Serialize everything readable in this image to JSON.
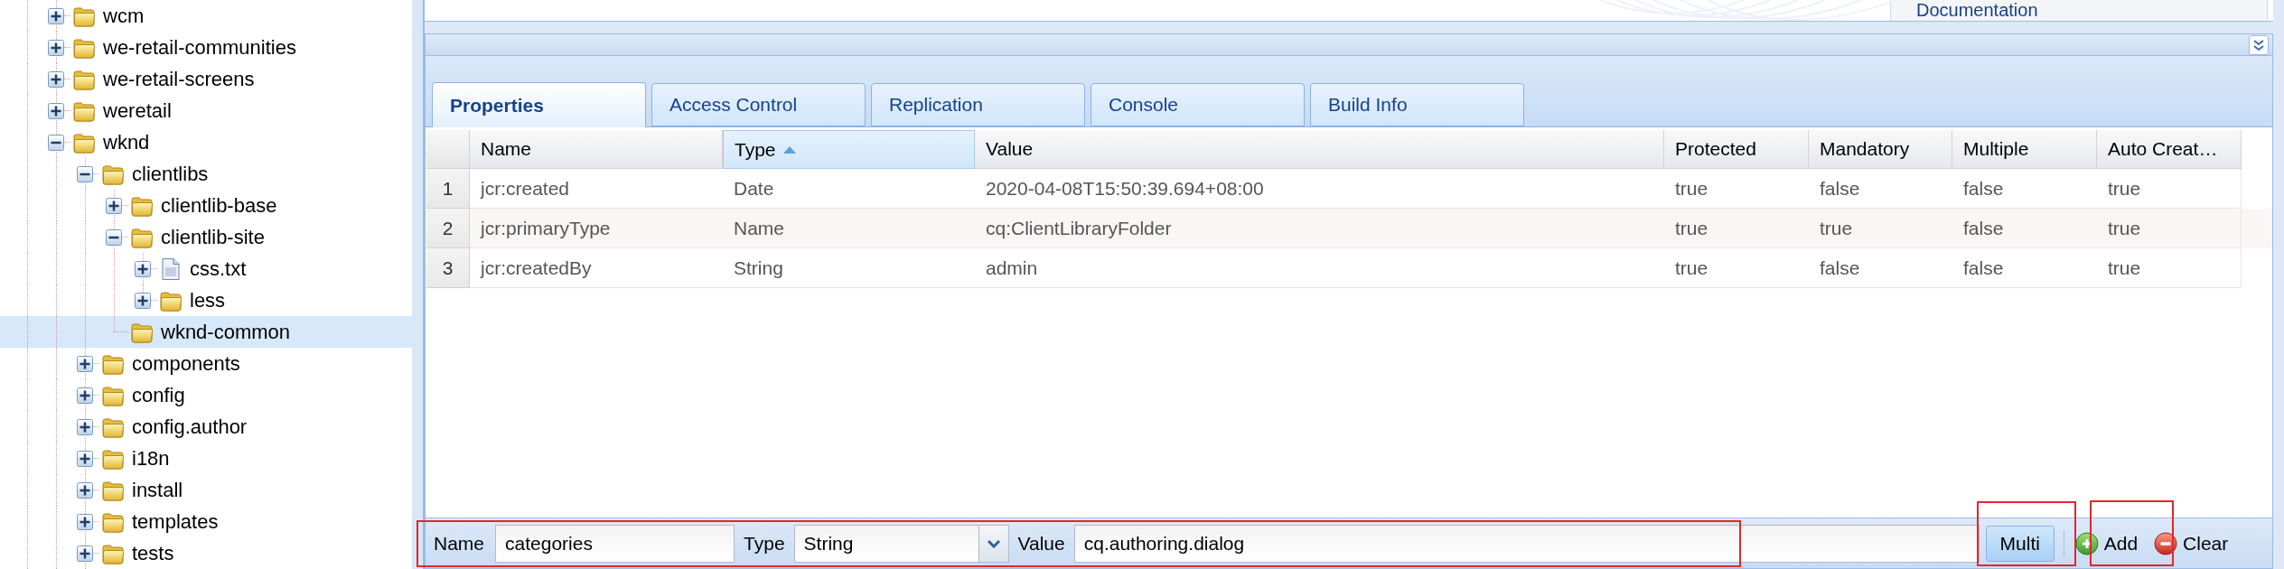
{
  "tree": [
    {
      "label": "wcm",
      "kind": "folder",
      "leaf": false,
      "expanded": false,
      "selected": false
    },
    {
      "label": "we-retail-communities",
      "kind": "folder",
      "leaf": false,
      "expanded": false,
      "selected": false
    },
    {
      "label": "we-retail-screens",
      "kind": "folder",
      "leaf": false,
      "expanded": false,
      "selected": false
    },
    {
      "label": "weretail",
      "kind": "folder",
      "leaf": false,
      "expanded": false,
      "selected": false
    },
    {
      "label": "wknd",
      "kind": "folder",
      "leaf": false,
      "expanded": true,
      "selected": false,
      "children": [
        {
          "label": "clientlibs",
          "kind": "folder",
          "leaf": false,
          "expanded": true,
          "selected": false,
          "children": [
            {
              "label": "clientlib-base",
              "kind": "folder",
              "leaf": false,
              "expanded": false,
              "selected": false
            },
            {
              "label": "clientlib-site",
              "kind": "folder",
              "leaf": false,
              "expanded": true,
              "selected": false,
              "children": [
                {
                  "label": "css.txt",
                  "kind": "file",
                  "leaf": false,
                  "expanded": false,
                  "selected": false
                },
                {
                  "label": "less",
                  "kind": "folder",
                  "leaf": false,
                  "expanded": false,
                  "selected": false
                }
              ]
            },
            {
              "label": "wknd-common",
              "kind": "folder",
              "leaf": true,
              "selected": true
            }
          ]
        },
        {
          "label": "components",
          "kind": "folder",
          "leaf": false,
          "expanded": false,
          "selected": false
        },
        {
          "label": "config",
          "kind": "folder",
          "leaf": false,
          "expanded": false,
          "selected": false
        },
        {
          "label": "config.author",
          "kind": "folder",
          "leaf": false,
          "expanded": false,
          "selected": false
        },
        {
          "label": "i18n",
          "kind": "folder",
          "leaf": false,
          "expanded": false,
          "selected": false
        },
        {
          "label": "install",
          "kind": "folder",
          "leaf": false,
          "expanded": false,
          "selected": false
        },
        {
          "label": "templates",
          "kind": "folder",
          "leaf": false,
          "expanded": false,
          "selected": false
        },
        {
          "label": "tests",
          "kind": "folder",
          "leaf": false,
          "expanded": false,
          "selected": false
        }
      ]
    }
  ],
  "top_panel": {
    "link": "Documentation"
  },
  "tabs": [
    {
      "label": "Properties",
      "selected": true
    },
    {
      "label": "Access Control",
      "selected": false
    },
    {
      "label": "Replication",
      "selected": false
    },
    {
      "label": "Console",
      "selected": false
    },
    {
      "label": "Build Info",
      "selected": false
    }
  ],
  "table": {
    "columns": [
      {
        "label": "Name",
        "sorted": false
      },
      {
        "label": "Type",
        "sorted": true
      },
      {
        "label": "Value",
        "sorted": false
      },
      {
        "label": "Protected",
        "sorted": false
      },
      {
        "label": "Mandatory",
        "sorted": false
      },
      {
        "label": "Multiple",
        "sorted": false
      },
      {
        "label": "Auto Creat…",
        "sorted": false
      }
    ],
    "rows": [
      {
        "number": "1",
        "cells": [
          "jcr:created",
          "Date",
          "2020-04-08T15:50:39.694+08:00",
          "true",
          "false",
          "false",
          "true"
        ]
      },
      {
        "number": "2",
        "cells": [
          "jcr:primaryType",
          "Name",
          "cq:ClientLibraryFolder",
          "true",
          "true",
          "false",
          "true"
        ]
      },
      {
        "number": "3",
        "cells": [
          "jcr:createdBy",
          "String",
          "admin",
          "true",
          "false",
          "false",
          "true"
        ]
      }
    ]
  },
  "toolbar": {
    "fields_highlighted": true,
    "fields": [
      {
        "kind": "text",
        "label": "Name",
        "value": "categories"
      },
      {
        "kind": "combo",
        "label": "Type",
        "value": "String"
      },
      {
        "kind": "text",
        "label": "Value",
        "value": "cq.authoring.dialog"
      }
    ],
    "buttons": [
      {
        "kind": "multi",
        "label": "Multi",
        "highlighted": true
      },
      {
        "kind": "add",
        "label": "Add",
        "highlighted": true
      },
      {
        "kind": "clear",
        "label": "Clear",
        "highlighted": false
      }
    ]
  }
}
